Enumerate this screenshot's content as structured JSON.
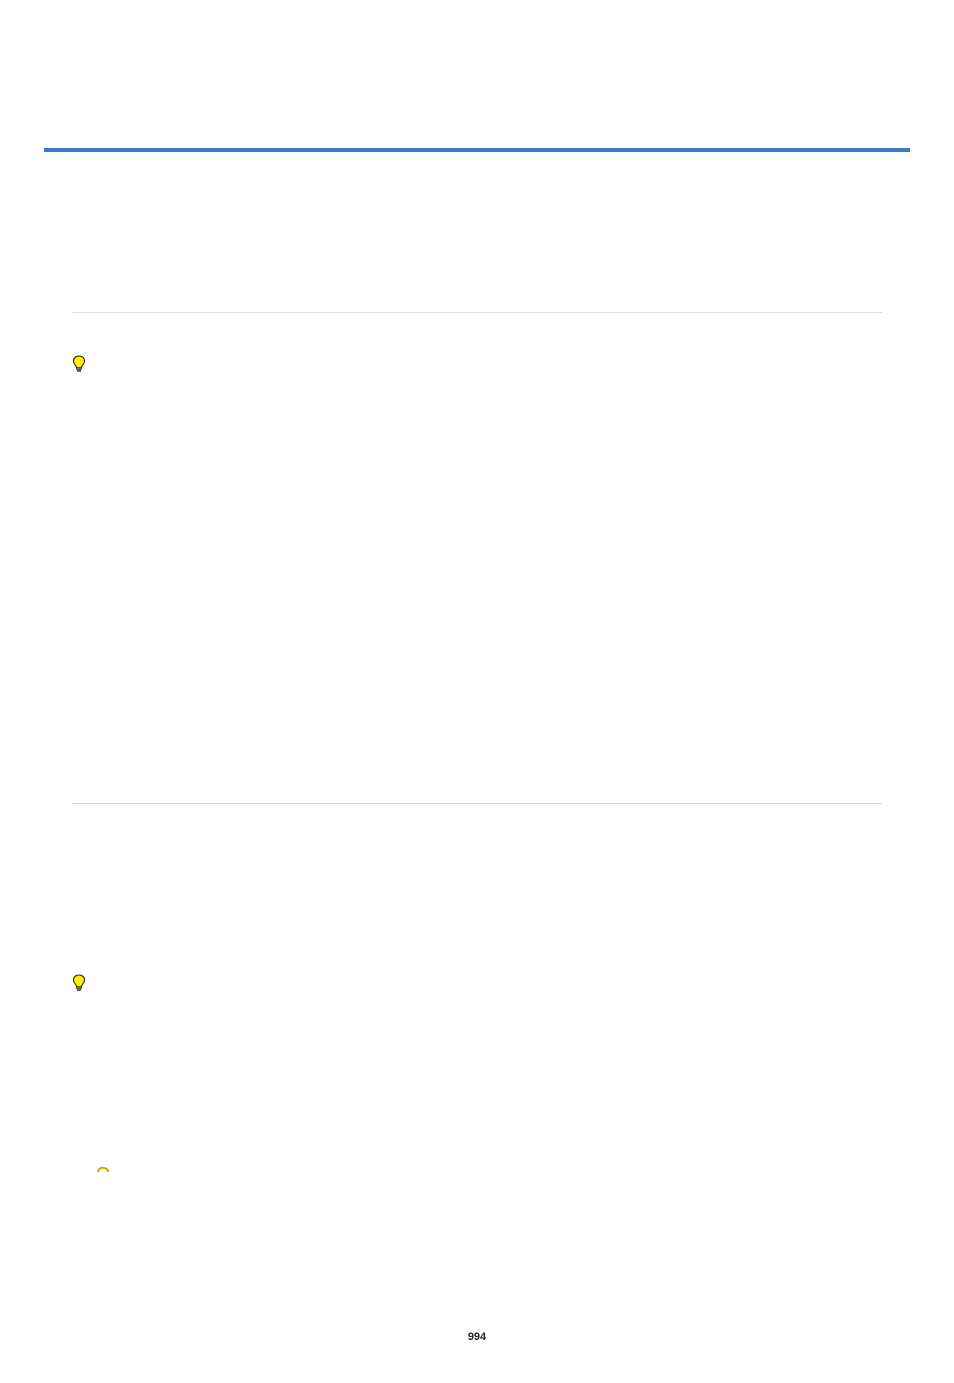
{
  "page": {
    "number": "994"
  },
  "icons": {
    "tip1": "lightbulb-icon",
    "tip2": "lightbulb-icon",
    "note_partial": "note-ring-icon"
  }
}
